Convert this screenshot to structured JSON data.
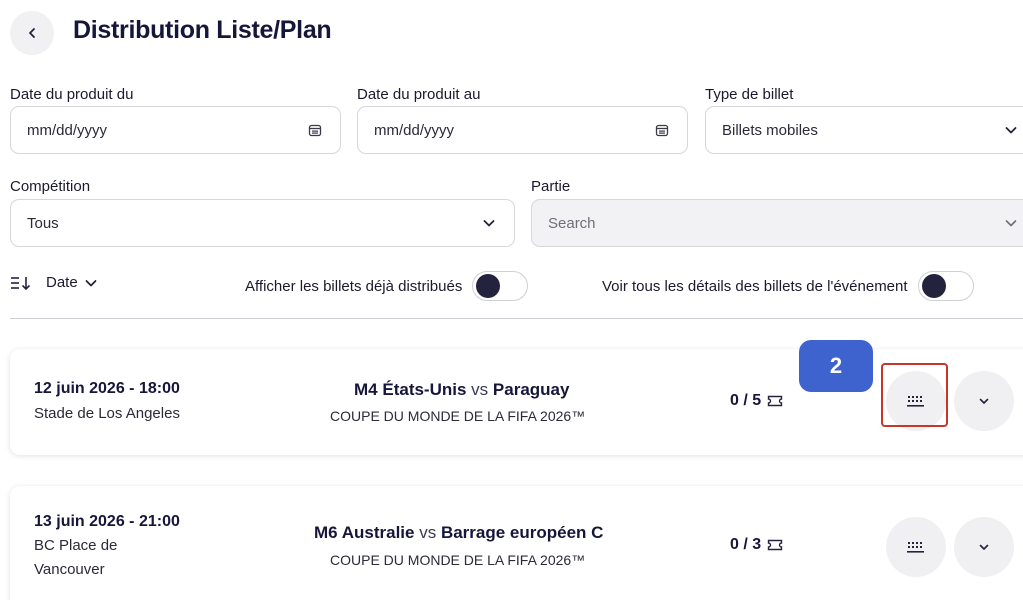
{
  "header": {
    "title": "Distribution Liste/Plan"
  },
  "filters": {
    "date_from": {
      "label": "Date du produit du",
      "placeholder": "mm/dd/yyyy"
    },
    "date_to": {
      "label": "Date du produit au",
      "placeholder": "mm/dd/yyyy"
    },
    "ticket_type": {
      "label": "Type de billet",
      "value": "Billets mobiles"
    },
    "competition": {
      "label": "Compétition",
      "value": "Tous"
    },
    "match": {
      "label": "Partie",
      "placeholder": "Search"
    }
  },
  "controls": {
    "sort_label": "Date",
    "toggle_distributed": "Afficher les billets déjà distribués",
    "toggle_details": "Voir tous les détails des billets de l'événement"
  },
  "annotation": {
    "badge": "2"
  },
  "events": [
    {
      "datetime": "12 juin 2026 - 18:00",
      "venue": "Stade de Los Angeles",
      "code": "M4",
      "home": "États-Unis",
      "vs": "vs",
      "away": "Paraguay",
      "competition": "COUPE DU MONDE DE LA FIFA 2026™",
      "count": "0 / 5"
    },
    {
      "datetime": "13 juin 2026 - 21:00",
      "venue": "BC Place de Vancouver",
      "code": "M6",
      "home": "Australie",
      "vs": "vs",
      "away": "Barrage européen C",
      "competition": "COUPE DU MONDE DE LA FIFA 2026™",
      "count": "0 / 3"
    }
  ],
  "colors": {
    "accent_badge": "#3f63ce",
    "highlight": "#c0392b",
    "text": "#16163a"
  }
}
